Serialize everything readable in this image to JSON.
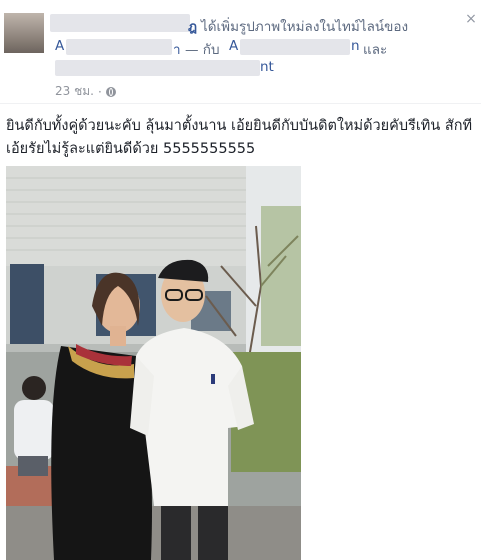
{
  "post": {
    "author_name": "",
    "action_text": "ได้เพิ่มรูปภาพใหม่ลงในไทม์ไลน์ของ",
    "with_text": "— กับ",
    "and_text": "และ",
    "name_suffix_1": "ฎ",
    "name_initial": "A",
    "name_suffix_2": "า",
    "name_initial_2": "A",
    "name_suffix_3": "n",
    "name_suffix_4": "nt",
    "timestamp": "23 ชม.",
    "separator": "·",
    "privacy_icon": "globe-icon",
    "message": "ยินดีกับทั้งคู่ด้วยนะคับ ลุ้นมาตั้งนาน เอ้ยยินดีกับบันดิตใหม่ด้วยคับรีเทิน สักที เอ้ยรัยไม่รู้ละแต่ยินดีด้วย 5555555555"
  },
  "controls": {
    "close_icon": "close-icon",
    "close_glyph": "×"
  },
  "photo": {
    "description_colors": {
      "sky": "#e9ecee",
      "building": "#d7d9d6",
      "grass": "#7a8f55"
    }
  }
}
